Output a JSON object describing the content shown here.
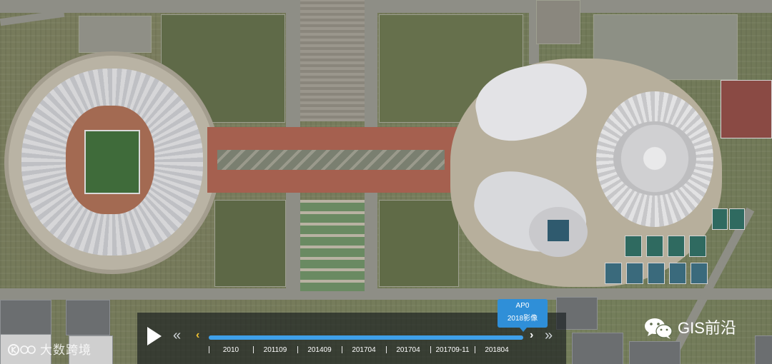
{
  "icons": {
    "play": "play-icon",
    "skip_back": "double-chevron-left-icon",
    "step_back": "chevron-left-icon",
    "step_fwd": "chevron-right-icon",
    "skip_fwd": "double-chevron-right-icon",
    "wechat": "wechat-icon"
  },
  "colors": {
    "accent": "#3fa0ea",
    "tooltip_bg": "#2f8fd8",
    "step_back_arrow": "#f1c232",
    "timeline_bg": "rgba(20,24,28,0.62)"
  },
  "timeline": {
    "skip_back_label": "«",
    "step_back_label": "‹",
    "step_fwd_label": "›",
    "skip_fwd_label": "»",
    "progress_fraction": 1.0,
    "ticks": [
      {
        "label": "2010"
      },
      {
        "label": "201109"
      },
      {
        "label": "201409"
      },
      {
        "label": "201704"
      },
      {
        "label": "201704"
      },
      {
        "label": "201709-11"
      },
      {
        "label": "201804"
      }
    ]
  },
  "tooltip": {
    "line1": "AP0",
    "line2": "2018影像"
  },
  "watermarks": {
    "left_text": "大数跨境",
    "right_text": "GIS前沿"
  }
}
